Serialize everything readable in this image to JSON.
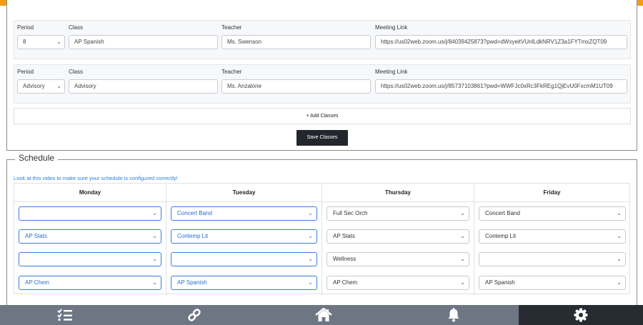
{
  "classes": {
    "labels": {
      "period": "Period",
      "class": "Class",
      "teacher": "Teacher",
      "meeting_link": "Meeting Link"
    },
    "rows": [
      {
        "period": "8",
        "class": "AP Spanish",
        "teacher": "Ms. Swenson",
        "meeting_link": "https://us02web.zoom.us/j/84039425873?pwd=dWxyeitVUnlLdkNRV1Z3a1FYTmxZQT09"
      },
      {
        "period": "Advisory",
        "class": "Advisory",
        "teacher": "Ms. Anzalone",
        "meeting_link": "https://us02web.zoom.us/j/85737103861?pwd=WWFJc0xRc3FkREg1QjEvU0FxcmM1UT09"
      }
    ],
    "add_label": "+ Add Classes",
    "save_label": "Save Classes"
  },
  "schedule": {
    "title": "Schedule",
    "video_link": "Look at this video to make sure your schedule is configured correctly!",
    "days": [
      "Monday",
      "Tuesday",
      "Thursday",
      "Friday"
    ],
    "rows": [
      [
        "",
        "Concert Band",
        "Full Sec Orch",
        "Concert Band"
      ],
      [
        "AP Stats",
        "Contemp Lit",
        "AP Stats",
        "Contemp Lit"
      ],
      [
        "",
        "",
        "Wellness",
        ""
      ],
      [
        "AP Chem",
        "AP Spanish",
        "AP Chem",
        "AP Spanish"
      ]
    ]
  },
  "nav": {
    "items": [
      {
        "icon": "checklist-icon"
      },
      {
        "icon": "link-icon"
      },
      {
        "icon": "home-icon"
      },
      {
        "icon": "bell-icon"
      },
      {
        "icon": "gear-icon",
        "active": true
      }
    ]
  },
  "colors": {
    "accent": "#f39c12",
    "nav_bg": "#6e7684",
    "nav_active": "#272c33",
    "link": "#2a7de1",
    "select_border_blue": "#3b7ddd"
  }
}
